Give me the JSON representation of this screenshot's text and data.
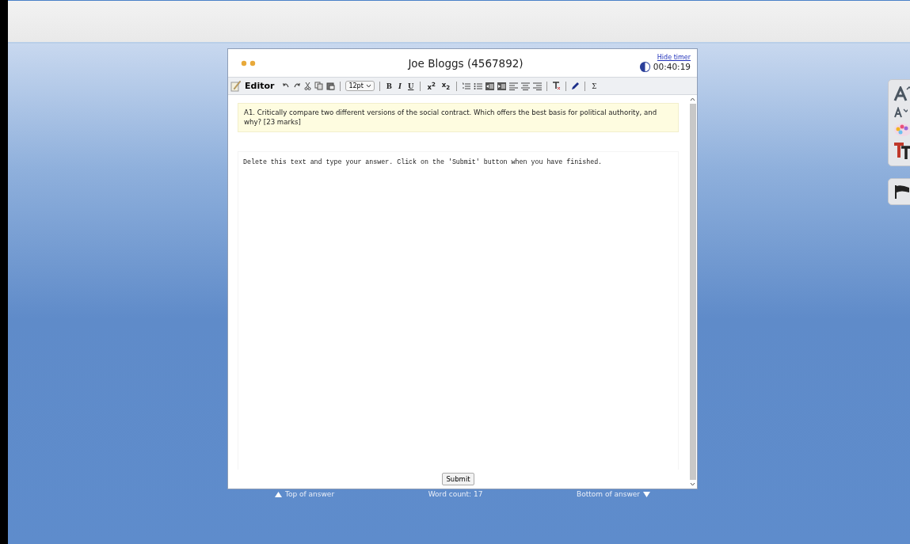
{
  "dialog": {
    "title": "Joe Bloggs (4567892)",
    "hide_timer_link": "Hide timer",
    "timer": "00:40:19"
  },
  "toolbar": {
    "editor_label": "Editor",
    "font_size": "12pt",
    "format_buttons": [
      "B",
      "I",
      "U"
    ],
    "script_buttons": [
      "x$^{2}$",
      "x$_{2}$"
    ],
    "symbol_button": "Σ"
  },
  "question": "A1. Critically compare two different versions of the social contract. Which offers the best basis for political authority, and why? [23 marks]",
  "answer": {
    "value": "Delete this text and type your answer. Click on the 'Submit' button when you have finished."
  },
  "submit_button": "Submit",
  "footer": {
    "top_link": "Top of answer",
    "word_count": "Word count: 17",
    "bottom_link": "Bottom of answer"
  }
}
